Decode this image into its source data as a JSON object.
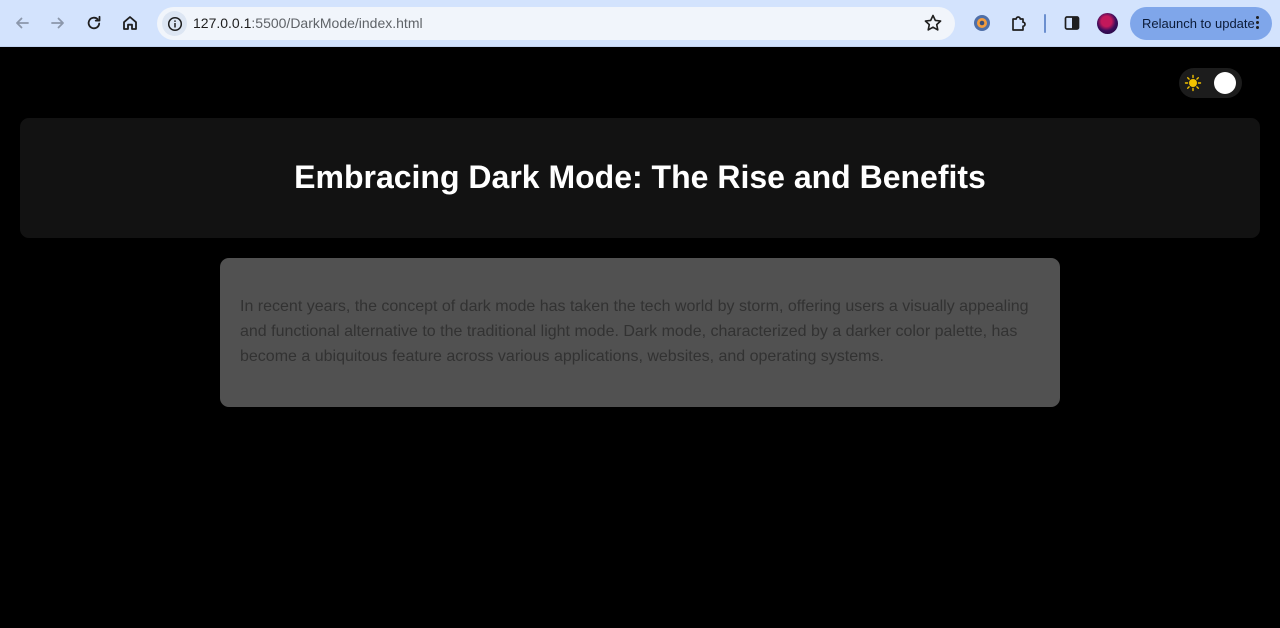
{
  "browser": {
    "url_host": "127.0.0.1",
    "url_path": ":5500/DarkMode/index.html",
    "relaunch_label": "Relaunch to update",
    "icons": [
      "back-arrow-icon",
      "forward-arrow-icon",
      "reload-icon",
      "home-icon",
      "site-info-icon",
      "bookmark-star-icon",
      "extension-shield-icon",
      "extensions-puzzle-icon",
      "side-panel-icon",
      "profile-avatar",
      "more-vert-icon"
    ]
  },
  "page": {
    "theme_toggle": {
      "icon": "sun-icon",
      "state": "dark"
    },
    "title": "Embracing Dark Mode: The Rise and Benefits",
    "paragraph": "In recent years, the concept of dark mode has taken the tech world by storm, offering users a visually appealing and functional alternative to the traditional light mode. Dark mode, characterized by a darker color palette, has become a ubiquitous feature across various applications, websites, and operating systems."
  },
  "colors": {
    "page_background": "#000000",
    "hero_background": "#121212",
    "card_background": "#515151",
    "card_text": "#323232",
    "title_text": "#ffffff",
    "browser_toolbar": "#d3e3fd",
    "relaunch_button": "#7fa6ea",
    "sun_icon": "#f2c200"
  }
}
